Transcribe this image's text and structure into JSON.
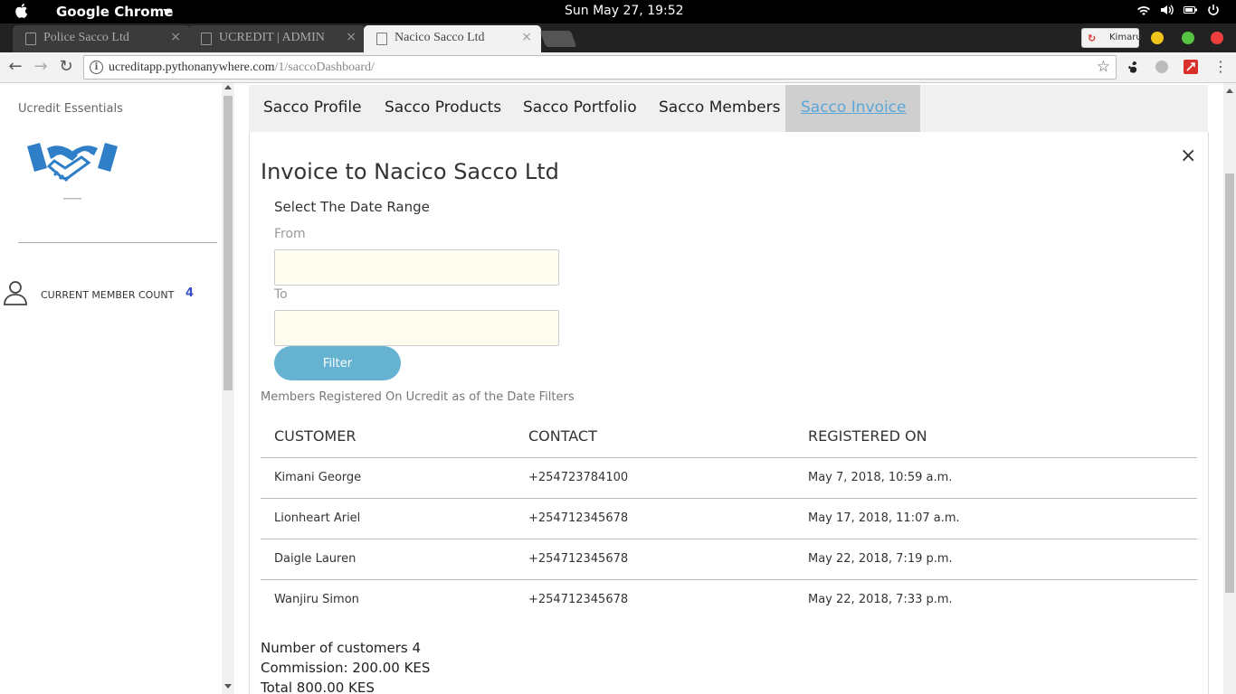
{
  "os": {
    "app_name": "Google Chrome",
    "clock": "Sun May 27, 19:52"
  },
  "browser": {
    "tabs": [
      {
        "label": "Police Sacco Ltd",
        "close": "×"
      },
      {
        "label": "UCREDIT | ADMIN",
        "close": "×"
      },
      {
        "label": "Nacico Sacco Ltd",
        "close": "×"
      }
    ],
    "extension_badge": "Kimaru",
    "url_host": "ucreditapp.pythonanywhere.com",
    "url_path": "/1/saccoDashboard/"
  },
  "sidebar": {
    "brand": "Ucredit Essentials",
    "member_count_label": "CURRENT MEMBER COUNT",
    "member_count": "4"
  },
  "nav_tabs": [
    {
      "label": "Sacco Profile"
    },
    {
      "label": "Sacco Products"
    },
    {
      "label": "Sacco Portfolio"
    },
    {
      "label": "Sacco Members"
    },
    {
      "label": "Sacco Invoice"
    }
  ],
  "invoice": {
    "close": "×",
    "title": "Invoice to Nacico Sacco Ltd",
    "range_title": "Select The Date Range",
    "from_label": "From",
    "to_label": "To",
    "from_value": "",
    "to_value": "",
    "filter_label": "Filter",
    "note": "Members Registered On Ucredit as of the Date Filters",
    "columns": [
      "CUSTOMER",
      "CONTACT",
      "REGISTERED ON"
    ],
    "rows": [
      [
        "Kimani George",
        "+254723784100",
        "May 7, 2018, 10:59 a.m."
      ],
      [
        "Lionheart Ariel",
        "+254712345678",
        "May 17, 2018, 11:07 a.m."
      ],
      [
        "Daigle Lauren",
        "+254712345678",
        "May 22, 2018, 7:19 p.m."
      ],
      [
        "Wanjiru Simon",
        "+254712345678",
        "May 22, 2018, 7:33 p.m."
      ]
    ],
    "summary": {
      "customers": "Number of customers 4",
      "commission": "Commission: 200.00 KES",
      "total": "Total 800.00 KES"
    }
  },
  "colors": {
    "accent": "#65b2d1",
    "active_tab_text": "#5aa6d6",
    "member_count": "#3a4fc4",
    "logo_blue": "#2f7fc8"
  }
}
